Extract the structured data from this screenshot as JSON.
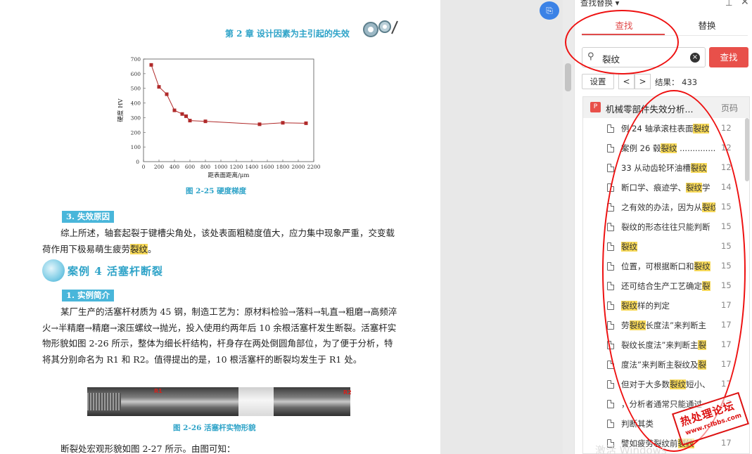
{
  "document": {
    "chapter_header": "第 2 章   设计因素为主引起的失效",
    "chart_figure_caption": "图 2-25   硬度梯度",
    "section3_tag": "3. 失效原因",
    "section3_text_pre": "综上所述，轴套起裂于键槽尖角处，该处表面粗糙度值大，应力集中现象严重，交变载荷作用下极易萌生疲劳",
    "section3_highlight": "裂纹",
    "section3_text_post": "。",
    "case_title": "案例 4   活塞杆断裂",
    "section1_tag": "1. 实例简介",
    "section1_text": "某厂生产的活塞杆材质为 45 钢，制造工艺为：原材料检验→落料→轧直→粗磨→高频淬火→半精磨→精磨→滚压螺纹→抛光，投入使用约两年后 10 余根活塞杆发生断裂。活塞杆实物形貌如图 2-26 所示，整体为细长杆结构，杆身存在两处倒圆角部位，为了便于分析，特将其分别命名为 R1 和 R2。值得提出的是，10 根活塞杆的断裂均发生于 R1 处。",
    "photo_label_r1": "R1",
    "photo_label_r2": "R2",
    "photo_caption": "图 2-26   活塞杆实物形貌",
    "last_line": "断裂处宏观形貌如图 2-27 所示。由图可知："
  },
  "chart_data": {
    "type": "line",
    "xlabel": "距表面距离/μm",
    "ylabel": "硬度  HV",
    "xlim": [
      0,
      2200
    ],
    "ylim": [
      0,
      700
    ],
    "xticks": [
      0,
      200,
      400,
      600,
      800,
      1000,
      1200,
      1400,
      1600,
      1800,
      2000,
      2200
    ],
    "yticks": [
      100,
      200,
      300,
      400,
      500,
      600,
      700
    ],
    "x": [
      100,
      200,
      300,
      400,
      500,
      550,
      600,
      800,
      1500,
      1800,
      2100
    ],
    "y": [
      660,
      510,
      460,
      350,
      325,
      310,
      280,
      275,
      255,
      265,
      262
    ],
    "grid": false,
    "color": "#b02a2a"
  },
  "panel": {
    "float_button": "⎘",
    "title": "查找替换 ▾",
    "pin_icon": "⊥",
    "close_icon": "✕",
    "tab_find": "查找",
    "tab_replace": "替换",
    "search_value": "裂纹",
    "find_button": "查找",
    "settings_button": "设置",
    "prev": "<",
    "next": ">",
    "result_text": "结果： 433",
    "group_name": "机械零部件失效分析...",
    "group_col": "页码",
    "items": [
      {
        "pre": "例 24 轴承滚柱表面",
        "hl": "裂纹",
        "post": "",
        "page": "12"
      },
      {
        "pre": "案例 26 毂",
        "hl": "裂纹",
        "post": " ...............",
        "page": "12"
      },
      {
        "pre": "33 从动齿轮环油槽",
        "hl": "裂纹",
        "post": "",
        "page": "12"
      },
      {
        "pre": "断口学、痕迹学、",
        "hl": "裂纹",
        "post": "学",
        "page": "14"
      },
      {
        "pre": "之有效的办法，因为从",
        "hl": "裂纹",
        "post": "",
        "page": "15"
      },
      {
        "pre": "裂纹的形态往往只能判断",
        "hl": "",
        "post": "",
        "page": "15"
      },
      {
        "pre": "",
        "hl": "裂纹",
        "post": "",
        "page": "15"
      },
      {
        "pre": "位置，可根据断口和",
        "hl": "裂纹",
        "post": "",
        "page": "15"
      },
      {
        "pre": "还可结合生产工艺确定",
        "hl": "裂",
        "post": "",
        "page": "15"
      },
      {
        "pre": "",
        "hl": "裂纹",
        "post": "样的判定",
        "page": "17"
      },
      {
        "pre": "劳",
        "hl": "裂纹",
        "post": "长度法”来判断主",
        "page": "17"
      },
      {
        "pre": "裂纹长度法”来判断主",
        "hl": "裂",
        "post": "",
        "page": "17"
      },
      {
        "pre": "度法”来判断主裂纹及",
        "hl": "裂",
        "post": "",
        "page": "17"
      },
      {
        "pre": "但对于大多数",
        "hl": "裂纹",
        "post": "短小、",
        "page": "17"
      },
      {
        "pre": "，分析者通常只能通过",
        "hl": "",
        "post": "",
        "page": "17"
      },
      {
        "pre": "判断其类",
        "hl": "",
        "post": "",
        "page": ""
      },
      {
        "pre": "譬如疲劳裂纹前",
        "hl": "裂纹",
        "post": "",
        "page": "17"
      }
    ]
  },
  "stamp": {
    "line1": "热处理论坛",
    "line2": "www.rclbbs.com"
  },
  "watermark": "激活 Windows"
}
